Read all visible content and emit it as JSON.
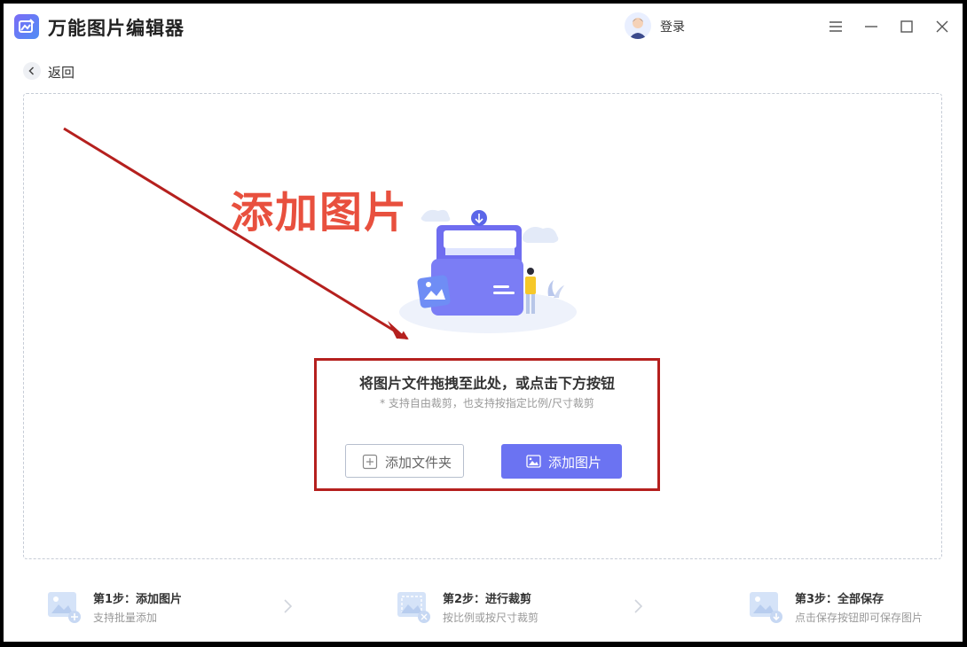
{
  "app": {
    "title": "万能图片编辑器",
    "login_label": "登录"
  },
  "nav": {
    "back_label": "返回"
  },
  "dropzone": {
    "title": "将图片文件拖拽至此处，或点击下方按钮",
    "subtitle": "* 支持自由裁剪，也支持按指定比例/尺寸裁剪",
    "add_folder_label": "添加文件夹",
    "add_image_label": "添加图片"
  },
  "annotation": {
    "text": "添加图片",
    "color": "#e8503e",
    "box_color": "#b5201e"
  },
  "steps": [
    {
      "title": "第1步：添加图片",
      "desc": "支持批量添加",
      "icon": "add-image-icon"
    },
    {
      "title": "第2步：进行裁剪",
      "desc": "按比例或按尺寸裁剪",
      "icon": "crop-image-icon"
    },
    {
      "title": "第3步：全部保存",
      "desc": "点击保存按钮即可保存图片",
      "icon": "save-image-icon"
    }
  ],
  "colors": {
    "accent": "#6b73f2",
    "step_icon": "#c9dcf7"
  }
}
